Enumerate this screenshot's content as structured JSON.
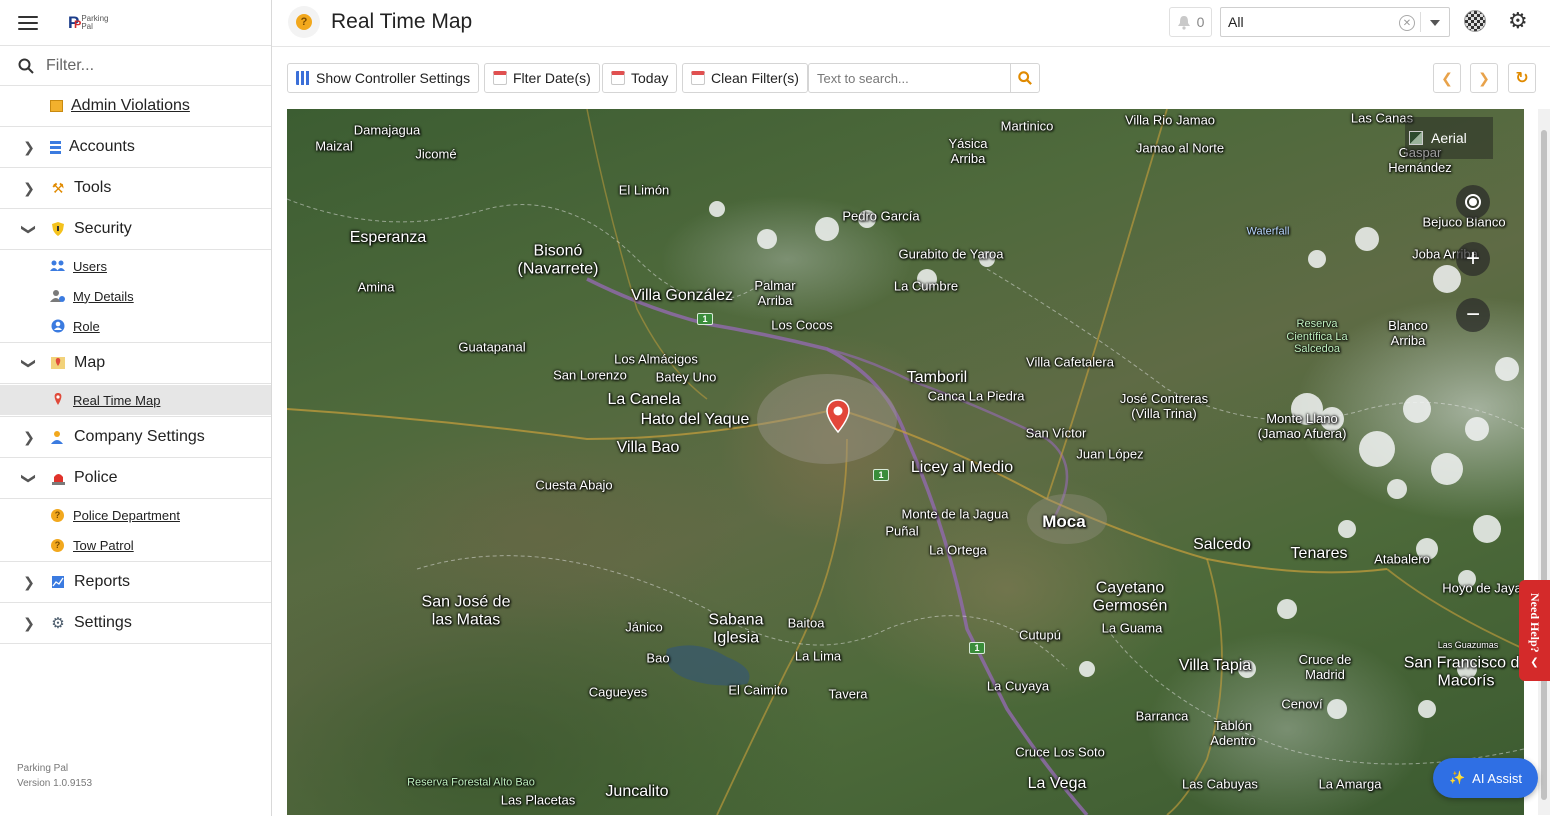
{
  "app": {
    "brand": "Parking Pal",
    "version": "Version 1.0.9153"
  },
  "header": {
    "title": "Real Time Map",
    "notification_count": "0",
    "scope_select": {
      "value": "All"
    }
  },
  "sidebar": {
    "filter_placeholder": "Filter...",
    "admin_violations": "Admin Violations",
    "accounts": "Accounts",
    "tools": "Tools",
    "security": "Security",
    "security_items": [
      "Users",
      "My Details",
      "Role"
    ],
    "map": "Map",
    "map_items": [
      "Real Time Map"
    ],
    "company_settings": "Company Settings",
    "police": "Police",
    "police_items": [
      "Police Department",
      "Tow Patrol"
    ],
    "reports": "Reports",
    "settings": "Settings"
  },
  "toolbar": {
    "show_controller_settings": "Show Controller Settings",
    "filter_dates": "Flter Date(s)",
    "today": "Today",
    "clean_filters": "Clean Filter(s)",
    "search_placeholder": "Text to search..."
  },
  "map": {
    "layer_label": "Aerial",
    "places": [
      "Damajagua",
      "Maizal",
      "Jicomé",
      "El Limón",
      "Martinico",
      "Yásica Arriba",
      "Villa Rio Jamao",
      "Jamao al Norte",
      "Las Canas",
      "Gaspar Hernández",
      "Esperanza",
      "Bisonó (Navarrete)",
      "Pedro García",
      "Gurabito de Yaroa",
      "Bejuco Blanco",
      "Waterfall",
      "Joba Arriba",
      "Amina",
      "Villa González",
      "Palmar Arriba",
      "La Cumbre",
      "Los Cocos",
      "Reserva Científica La Salcedoa",
      "Blanco Arriba",
      "Guatapanal",
      "Los Almácigos",
      "San Lorenzo",
      "Batey Uno",
      "Villa Cafetalera",
      "Tamboril",
      "Canca La Piedra",
      "José Contreras (Villa Trina)",
      "La Canela",
      "Hato del Yaque",
      "Monte Llano (Jamao Afuera)",
      "San Víctor",
      "Villa Bao",
      "Juan López",
      "Licey al Medio",
      "Cuesta Abajo",
      "Monte de la Jagua",
      "Moca",
      "Puñal",
      "La Ortega",
      "Salcedo",
      "Tenares",
      "Atabalero",
      "Cayetano Germosén",
      "San José de las Matas",
      "Hoyo de Jaya",
      "Jánico",
      "Sabana Iglesia",
      "Baitoa",
      "La Guama",
      "Cutupú",
      "Las Guazumas",
      "Bao",
      "La Lima",
      "Villa Tapia",
      "Cruce de Madrid",
      "San Francisco de Macorís",
      "Cagueyes",
      "El Caimito",
      "Tavera",
      "La Cuyaya",
      "Cenoví",
      "Barranca",
      "Tablón Adentro",
      "Cruce Los Soto",
      "Reserva Forestal Alto Bao",
      "Juncalito",
      "La Vega",
      "Las Placetas",
      "Las Cabuyas",
      "La Amarga"
    ],
    "route_shields": [
      "1",
      "1",
      "1"
    ]
  },
  "help": {
    "need_help": "Need Help?",
    "ai_assist": "AI Assist"
  },
  "colors": {
    "accent": "#e08a00",
    "ai_button": "#2f6fe4",
    "help_tab": "#d42a2a"
  }
}
